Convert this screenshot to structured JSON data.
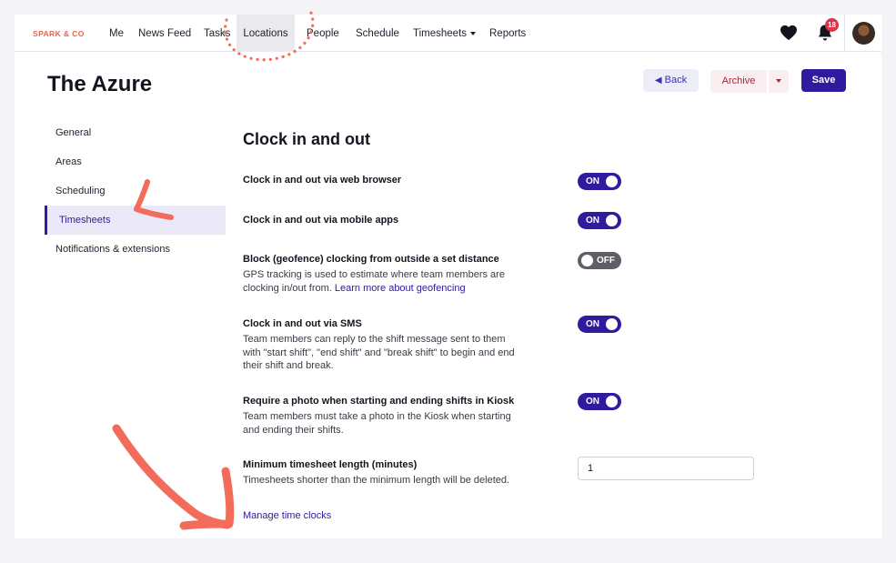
{
  "brand": "SPARK & CO",
  "nav": {
    "items": [
      {
        "label": "Me"
      },
      {
        "label": "News Feed"
      },
      {
        "label": "Tasks"
      },
      {
        "label": "Locations"
      },
      {
        "label": "People"
      },
      {
        "label": "Schedule"
      },
      {
        "label": "Timesheets"
      },
      {
        "label": "Reports"
      }
    ],
    "notification_count": "18"
  },
  "header": {
    "title": "The Azure",
    "back_label": "Back",
    "archive_label": "Archive",
    "save_label": "Save"
  },
  "sidebar": {
    "items": [
      {
        "label": "General"
      },
      {
        "label": "Areas"
      },
      {
        "label": "Scheduling"
      },
      {
        "label": "Timesheets"
      },
      {
        "label": "Notifications & extensions"
      }
    ]
  },
  "main": {
    "title": "Clock in and out",
    "settings": [
      {
        "title": "Clock in and out via web browser",
        "toggle": "ON"
      },
      {
        "title": "Clock in and out via mobile apps",
        "toggle": "ON"
      },
      {
        "title": "Block (geofence) clocking from outside a set distance",
        "desc": "GPS tracking is used to estimate where team members are clocking in/out from.",
        "link": "Learn more about geofencing",
        "toggle": "OFF"
      },
      {
        "title": "Clock in and out via SMS",
        "desc": "Team members can reply to the shift message sent to them with \"start shift\", \"end shift\" and \"break shift\" to begin and end their shift and break.",
        "toggle": "ON"
      },
      {
        "title": "Require a photo when starting and ending shifts in Kiosk",
        "desc": "Team members must take a photo in the Kiosk when starting and ending their shifts.",
        "toggle": "ON"
      },
      {
        "title": "Minimum timesheet length (minutes)",
        "desc": "Timesheets shorter than the minimum length will be deleted.",
        "value": "1"
      }
    ],
    "manage_link": "Manage time clocks"
  },
  "colors": {
    "accent": "#2e1b9e",
    "annotation": "#f26b5b",
    "toggle_off": "#5e5e66"
  }
}
